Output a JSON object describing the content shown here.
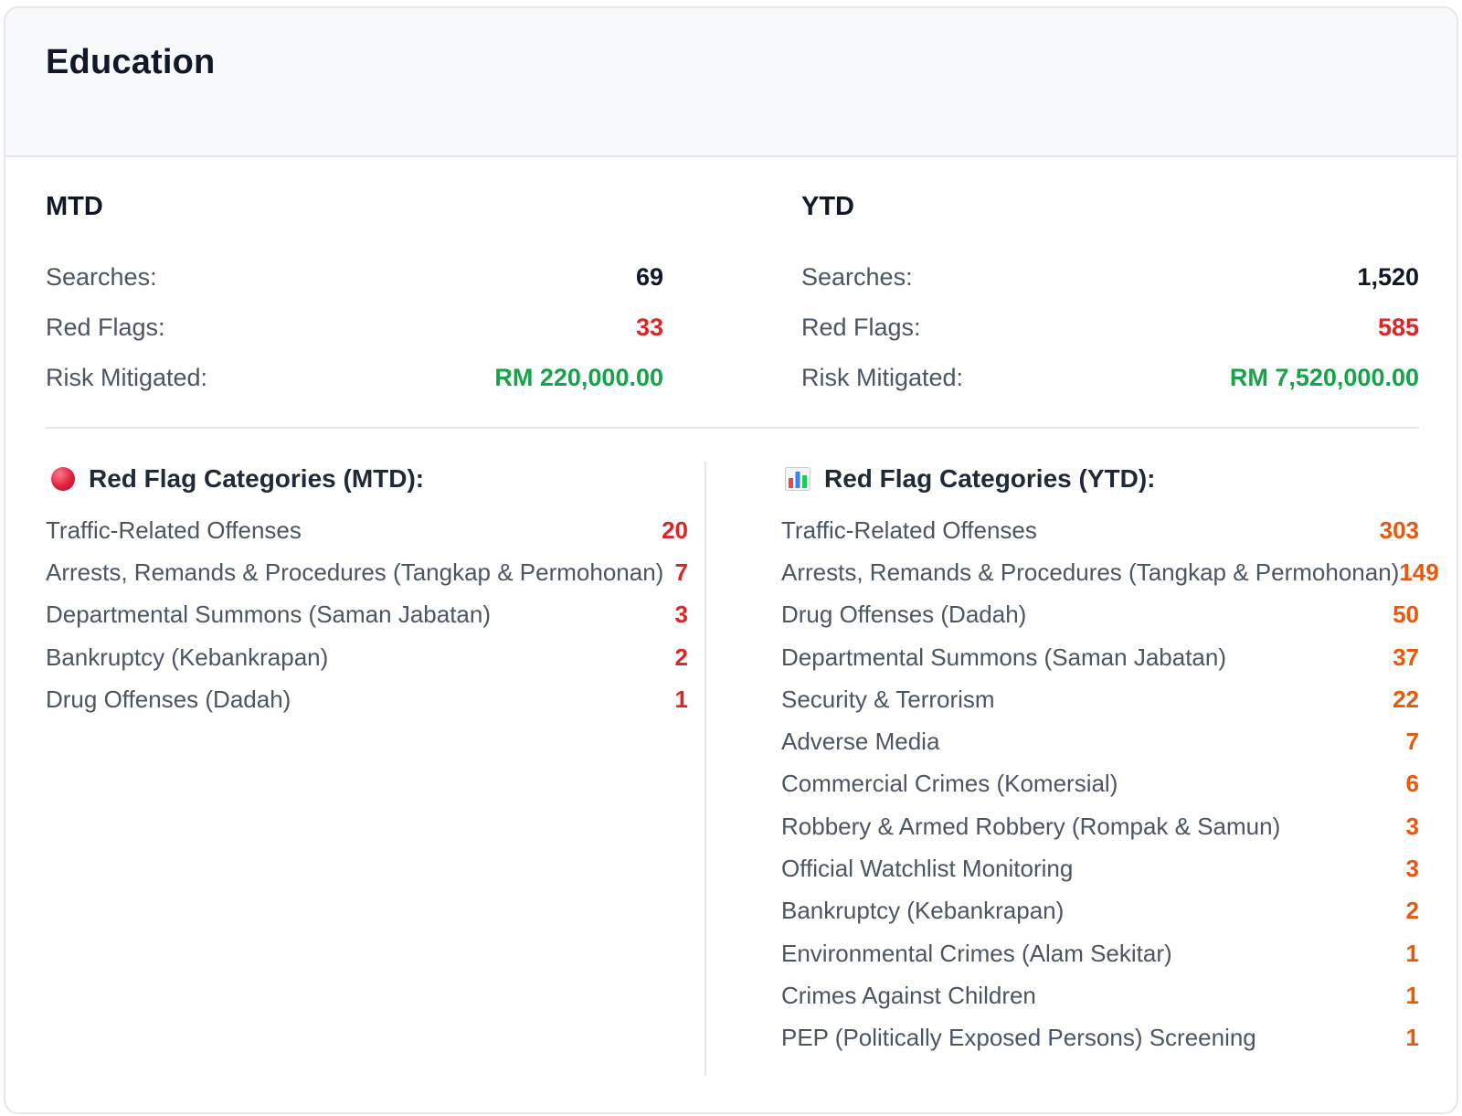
{
  "card": {
    "title": "Education"
  },
  "mtd": {
    "heading": "MTD",
    "searches_label": "Searches:",
    "searches_value": "69",
    "red_flags_label": "Red Flags:",
    "red_flags_value": "33",
    "risk_label": "Risk Mitigated:",
    "risk_value": "RM 220,000.00"
  },
  "ytd": {
    "heading": "YTD",
    "searches_label": "Searches:",
    "searches_value": "1,520",
    "red_flags_label": "Red Flags:",
    "red_flags_value": "585",
    "risk_label": "Risk Mitigated:",
    "risk_value": "RM 7,520,000.00"
  },
  "mtd_categories": {
    "icon": "red-circle-icon",
    "heading": "Red Flag Categories (MTD):",
    "items": [
      {
        "label": "Traffic-Related Offenses",
        "count": "20"
      },
      {
        "label": "Arrests, Remands & Procedures (Tangkap & Permohonan)",
        "count": "7"
      },
      {
        "label": "Departmental Summons (Saman Jabatan)",
        "count": "3"
      },
      {
        "label": "Bankruptcy (Kebankrapan)",
        "count": "2"
      },
      {
        "label": "Drug Offenses (Dadah)",
        "count": "1"
      }
    ]
  },
  "ytd_categories": {
    "icon": "bar-chart-icon",
    "heading": "Red Flag Categories (YTD):",
    "items": [
      {
        "label": "Traffic-Related Offenses",
        "count": "303"
      },
      {
        "label": "Arrests, Remands & Procedures (Tangkap & Permohonan)",
        "count": "149"
      },
      {
        "label": "Drug Offenses (Dadah)",
        "count": "50"
      },
      {
        "label": "Departmental Summons (Saman Jabatan)",
        "count": "37"
      },
      {
        "label": "Security & Terrorism",
        "count": "22"
      },
      {
        "label": "Adverse Media",
        "count": "7"
      },
      {
        "label": "Commercial Crimes (Komersial)",
        "count": "6"
      },
      {
        "label": "Robbery & Armed Robbery (Rompak & Samun)",
        "count": "3"
      },
      {
        "label": "Official Watchlist Monitoring",
        "count": "3"
      },
      {
        "label": "Bankruptcy (Kebankrapan)",
        "count": "2"
      },
      {
        "label": "Environmental Crimes (Alam Sekitar)",
        "count": "1"
      },
      {
        "label": "Crimes Against Children",
        "count": "1"
      },
      {
        "label": "PEP (Politically Exposed Persons) Screening",
        "count": "1"
      }
    ]
  },
  "colors": {
    "red": "#dc2626",
    "orange": "#ea580c",
    "green": "#16a34a",
    "text_dark": "#111827",
    "text_muted": "#4b5563"
  }
}
